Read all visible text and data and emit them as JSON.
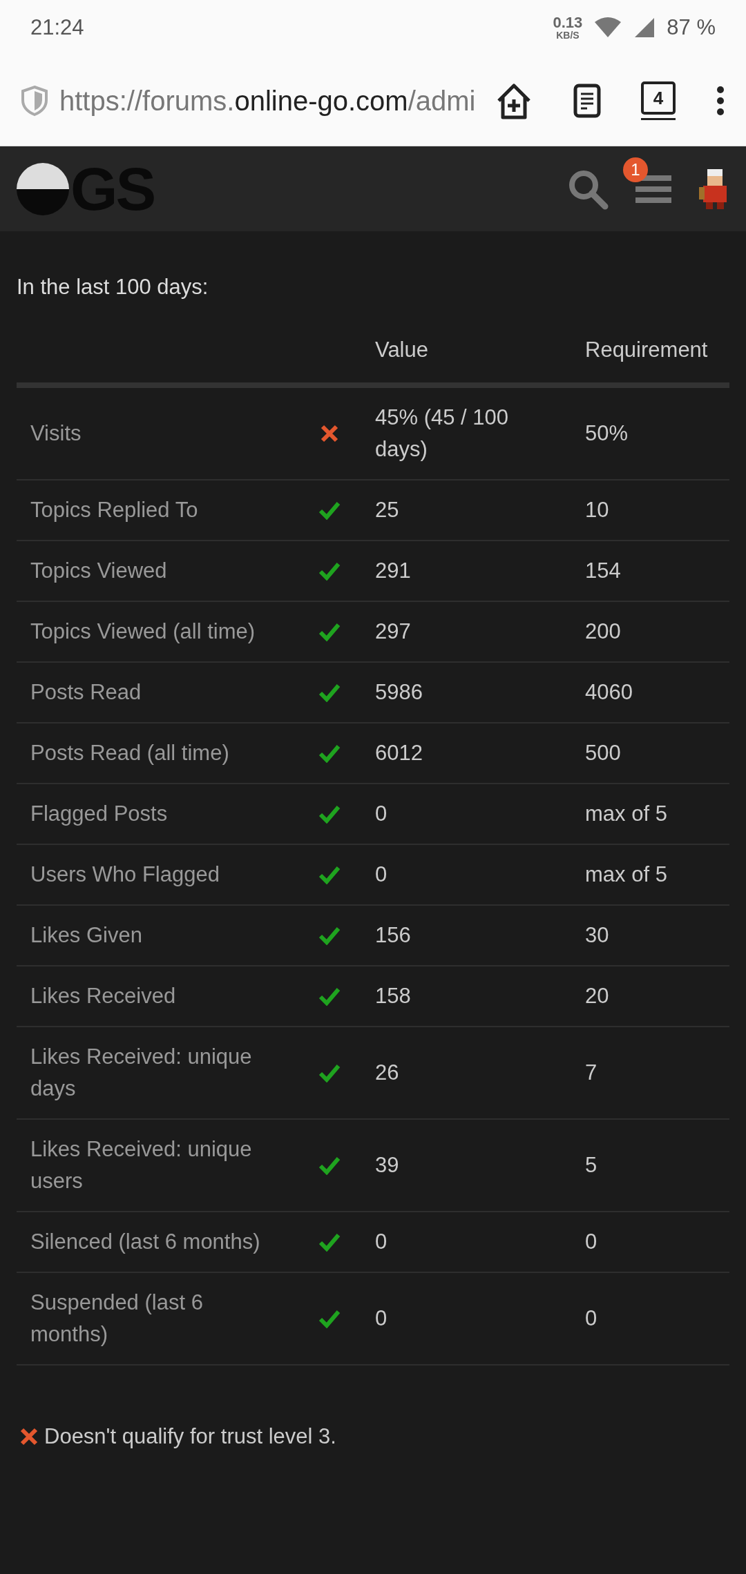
{
  "status_bar": {
    "time": "21:24",
    "speed": "0.13",
    "speed_unit": "KB/S",
    "battery": "87 %"
  },
  "browser": {
    "url": {
      "prefix": "https://forums.",
      "domain": "online-go.com",
      "suffix": "/admi"
    },
    "tab_count": "4"
  },
  "header": {
    "logo": "GS",
    "notification_count": "1"
  },
  "intro": "In the last 100 days:",
  "table": {
    "columns": [
      "Value",
      "Requirement"
    ],
    "rows": [
      {
        "label": "Visits",
        "met": false,
        "value": "45% (45 / 100 days)",
        "requirement": "50%"
      },
      {
        "label": "Topics Replied To",
        "met": true,
        "value": "25",
        "requirement": "10"
      },
      {
        "label": "Topics Viewed",
        "met": true,
        "value": "291",
        "requirement": "154"
      },
      {
        "label": "Topics Viewed (all time)",
        "met": true,
        "value": "297",
        "requirement": "200"
      },
      {
        "label": "Posts Read",
        "met": true,
        "value": "5986",
        "requirement": "4060"
      },
      {
        "label": "Posts Read (all time)",
        "met": true,
        "value": "6012",
        "requirement": "500"
      },
      {
        "label": "Flagged Posts",
        "met": true,
        "value": "0",
        "requirement": "max of 5"
      },
      {
        "label": "Users Who Flagged",
        "met": true,
        "value": "0",
        "requirement": "max of 5"
      },
      {
        "label": "Likes Given",
        "met": true,
        "value": "156",
        "requirement": "30"
      },
      {
        "label": "Likes Received",
        "met": true,
        "value": "158",
        "requirement": "20"
      },
      {
        "label": "Likes Received: unique days",
        "met": true,
        "value": "26",
        "requirement": "7"
      },
      {
        "label": "Likes Received: unique users",
        "met": true,
        "value": "39",
        "requirement": "5"
      },
      {
        "label": "Silenced (last 6 months)",
        "met": true,
        "value": "0",
        "requirement": "0"
      },
      {
        "label": "Suspended (last 6 months)",
        "met": true,
        "value": "0",
        "requirement": "0"
      }
    ]
  },
  "result": {
    "qualifies": false,
    "text": "Doesn't qualify for trust level 3."
  }
}
